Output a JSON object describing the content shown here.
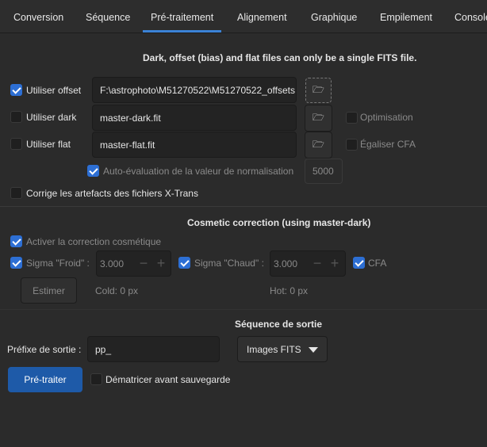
{
  "tabs": [
    "Conversion",
    "Séquence",
    "Pré-traitement",
    "Alignement",
    "Graphique",
    "Empilement",
    "Console"
  ],
  "active_tab": "Pré-traitement",
  "masters": {
    "heading": "Dark, offset (bias) and flat files can only be a single FITS file.",
    "offset": {
      "label": "Utiliser offset",
      "checked": true,
      "value": "F:\\astrophoto\\M51270522\\M51270522_offsets"
    },
    "dark": {
      "label": "Utiliser dark",
      "checked": false,
      "value": "master-dark.fit",
      "option_label": "Optimisation"
    },
    "flat": {
      "label": "Utiliser flat",
      "checked": false,
      "value": "master-flat.fit",
      "option_label": "Égaliser CFA"
    },
    "auto_norm": {
      "label": "Auto-évaluation de la valeur de normalisation",
      "checked": true,
      "value": "5000"
    },
    "xtrans": {
      "label": "Corrige les artefacts des fichiers X-Trans",
      "checked": false
    }
  },
  "cosmetic": {
    "heading": "Cosmetic correction (using master-dark)",
    "enable_label": "Activer la correction cosmétique",
    "cold_label": "Sigma \"Froid\" :",
    "cold_value": "3.000",
    "hot_label": "Sigma \"Chaud\" :",
    "hot_value": "3.000",
    "cfa_label": "CFA",
    "estimate_label": "Estimer",
    "cold_result": "Cold: 0 px",
    "hot_result": "Hot: 0 px"
  },
  "output": {
    "heading": "Séquence de sortie",
    "prefix_label": "Préfixe de sortie :",
    "prefix_value": "pp_",
    "format": "Images FITS",
    "run_label": "Pré-traiter",
    "debayer_label": "Dématricer avant sauvegarde"
  },
  "colors": {
    "accent": "#2d6fd4",
    "primary_button": "#1e5aa8",
    "background": "#2b2b2b"
  }
}
